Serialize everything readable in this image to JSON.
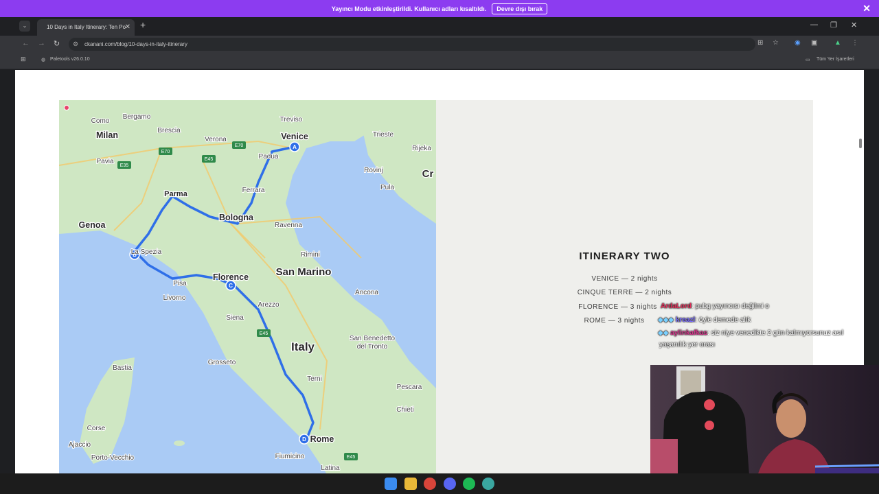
{
  "banner": {
    "message": "Yayıncı Modu etkinleştirildi. Kullanıcı adları kısaltıldı.",
    "disable_button": "Devre dışı bırak"
  },
  "browser": {
    "tab_title": "10 Days in Italy Itinerary: Ten Po",
    "url": "ckanani.com/blog/10-days-in-italy-itinerary",
    "bookmark_1": "Paletools v26.0.10",
    "all_bookmarks": "Tüm Yer İşaretleri"
  },
  "map": {
    "cities": [
      {
        "name": "Milan",
        "size": "large"
      },
      {
        "name": "Como",
        "size": "small"
      },
      {
        "name": "Bergamo",
        "size": "small"
      },
      {
        "name": "Brescia",
        "size": "small"
      },
      {
        "name": "Verona",
        "size": "small"
      },
      {
        "name": "Treviso",
        "size": "small"
      },
      {
        "name": "Venice",
        "size": "large"
      },
      {
        "name": "Trieste",
        "size": "small"
      },
      {
        "name": "Rijeka",
        "size": "small"
      },
      {
        "name": "Pavia",
        "size": "small"
      },
      {
        "name": "Padua",
        "size": "small"
      },
      {
        "name": "Rovinj",
        "size": "small"
      },
      {
        "name": "Cr",
        "size": "xlarge"
      },
      {
        "name": "Pula",
        "size": "small"
      },
      {
        "name": "Parma",
        "size": "medium"
      },
      {
        "name": "Ferrara",
        "size": "small"
      },
      {
        "name": "Genoa",
        "size": "large"
      },
      {
        "name": "Bologna",
        "size": "large"
      },
      {
        "name": "Ravenna",
        "size": "small"
      },
      {
        "name": "La Spezia",
        "size": "small"
      },
      {
        "name": "Rimini",
        "size": "small"
      },
      {
        "name": "San Marino",
        "size": "xlarge"
      },
      {
        "name": "Pisa",
        "size": "small"
      },
      {
        "name": "Florence",
        "size": "large"
      },
      {
        "name": "Livorno",
        "size": "small"
      },
      {
        "name": "Ancona",
        "size": "small"
      },
      {
        "name": "Arezzo",
        "size": "small"
      },
      {
        "name": "Siena",
        "size": "small"
      },
      {
        "name": "Italy",
        "size": "xxlarge"
      },
      {
        "name": "San Benedetto",
        "size": "small"
      },
      {
        "name": "del Tronto",
        "size": "small"
      },
      {
        "name": "Bastia",
        "size": "small"
      },
      {
        "name": "Grosseto",
        "size": "small"
      },
      {
        "name": "Terni",
        "size": "small"
      },
      {
        "name": "Pescara",
        "size": "small"
      },
      {
        "name": "Chieti",
        "size": "small"
      },
      {
        "name": "Corse",
        "size": "small"
      },
      {
        "name": "Ajaccio",
        "size": "small"
      },
      {
        "name": "Rome",
        "size": "large"
      },
      {
        "name": "Porto-Vecchio",
        "size": "small"
      },
      {
        "name": "Fiumicino",
        "size": "small"
      },
      {
        "name": "Latina",
        "size": "small"
      }
    ],
    "roads": [
      "E70",
      "E70",
      "E35",
      "E45",
      "E45",
      "E45"
    ],
    "markers": [
      "A",
      "B",
      "C",
      "D"
    ]
  },
  "itinerary": {
    "title": "ITINERARY TWO",
    "stops": [
      "VENICE — 2 nights",
      "CINQUE TERRE — 2 nights",
      "FLORENCE — 3 nights",
      "ROME — 3 nights"
    ]
  },
  "chat": [
    {
      "user": "ArdaLord",
      "message": ": pubg yayıncısı değilmi o",
      "color": "#e0305a"
    },
    {
      "user": "kreazl",
      "message": ": öyle demede alık",
      "color": "#7a6cff"
    },
    {
      "user": "aylinkafkas",
      "message": ": siz niye venedikte 2 gün kalmıyorsunuz asıl",
      "message2": "yaşanılık yer orası",
      "color": "#d8338c"
    }
  ],
  "colors": {
    "banner": "#8c3cf0",
    "route": "#2f6fe8",
    "water": "#aacbf5",
    "land": "#cfe7c3"
  }
}
